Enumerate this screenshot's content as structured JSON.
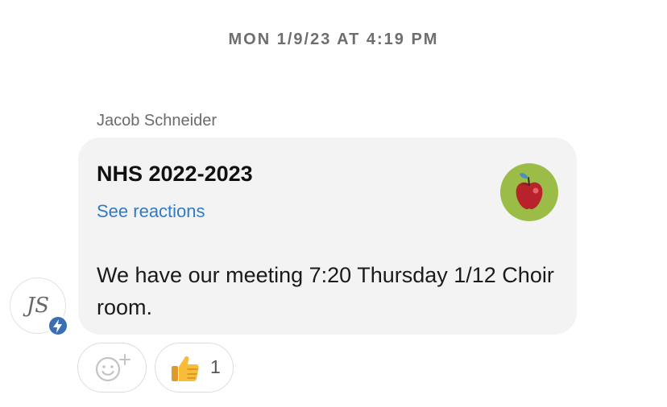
{
  "conversation": {
    "timestamp": "MON 1/9/23 AT 4:19 PM"
  },
  "message": {
    "sender": "Jacob Schneider",
    "group_title": "NHS 2022-2023",
    "see_reactions_label": "See reactions",
    "text": "We have our meeting 7:20 Thursday 1/12 Choir room.",
    "group_avatar_icon": "apple-icon",
    "group_avatar_color": "#9cbc48"
  },
  "sender_avatar": {
    "initials": "JS",
    "badge_icon": "lightning-bolt-icon",
    "badge_color": "#3b6fb3"
  },
  "reactions": {
    "add_icon": "add-reaction-smiley-icon",
    "items": [
      {
        "emoji_icon": "thumbs-up-icon",
        "count": "1"
      }
    ]
  },
  "colors": {
    "link": "#2f7ac9",
    "bubble_background": "#f3f3f3"
  }
}
